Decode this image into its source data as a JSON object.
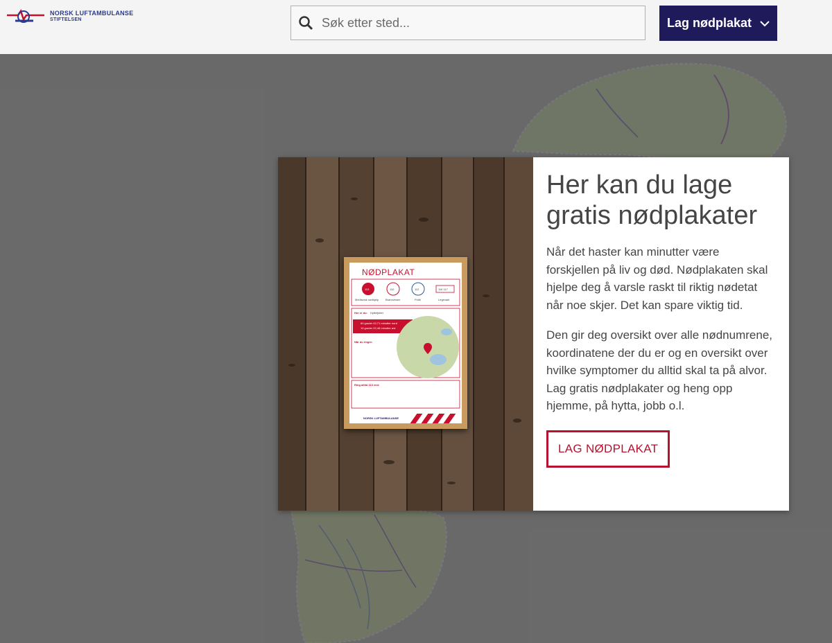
{
  "header": {
    "logo": {
      "line1": "NORSK LUFTAMBULANSE",
      "line2": "STIFTELSEN"
    },
    "search": {
      "placeholder": "Søk etter sted..."
    },
    "poster_button": {
      "label": "Lag nødplakat"
    }
  },
  "modal": {
    "title": "Her kan du lage gratis nødplakater",
    "paragraph1": "Når det haster kan minutter være forskjellen på liv og død. Nødplakaten skal hjelpe deg å varsle raskt til riktig nødetat når noe skjer. Det kan spare viktig tid.",
    "paragraph2": "Den gir deg oversikt over alle nødnumrene, koordinatene der du er og en oversikt over hvilke symptomer du alltid skal ta på alvor. Lag gratis nødplakater og heng opp hjemme, på hytta, jobb o.l.",
    "cta_label": "LAG NØDPLAKAT"
  },
  "poster_preview": {
    "title": "NØDPLAKAT",
    "numbers": [
      "113",
      "110",
      "112",
      "116 117"
    ],
    "number_labels": [
      "Medisinsk nødhjelp",
      "Brannvesen",
      "Politi",
      "Legevakt"
    ],
    "location_label": "Her er du:",
    "location_name": "Hyttefjellet",
    "coords_line1": "60 grader 42,71 minutter nord",
    "coords_line2": "10 grader 22,48 minutter øst",
    "call_heading": "Når du ringer:",
    "always_heading": "Ring alltid 113 ved:",
    "brand": "NORSK LUFTAMBULANSE",
    "colors": {
      "red": "#c8102e",
      "navy": "#1f1b5a"
    }
  },
  "colors": {
    "accent_navy": "#1f1b5a",
    "cta_red": "#b8112e",
    "text_gray": "#454545"
  }
}
